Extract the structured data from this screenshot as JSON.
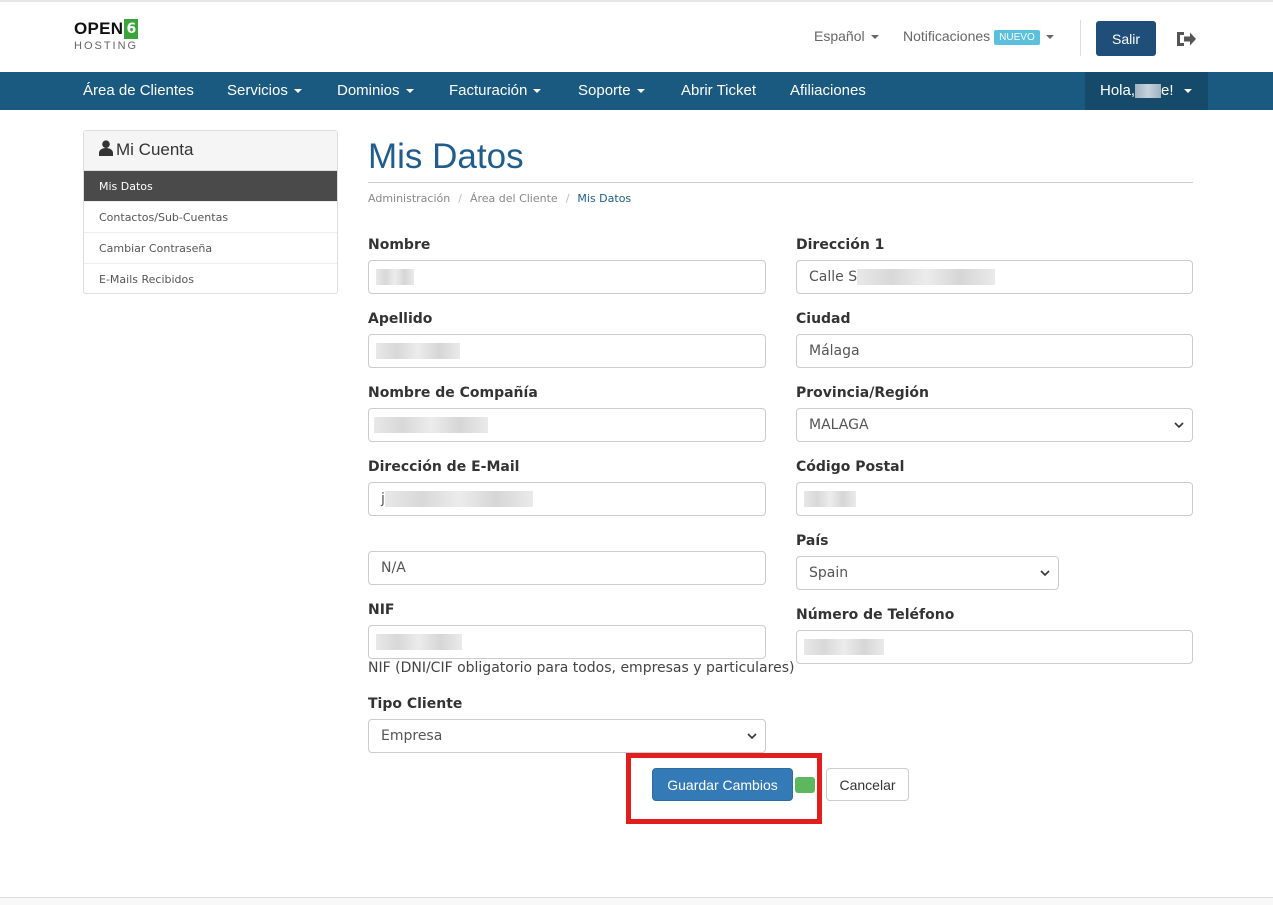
{
  "header": {
    "logo": {
      "brand": "OPEN",
      "digit": "6",
      "sub": "HOSTING"
    },
    "language": "Español",
    "notifications": "Notificaciones",
    "notif_badge": "NUEVO",
    "logout_button": "Salir"
  },
  "nav": {
    "items": [
      "Área de Clientes",
      "Servicios",
      "Dominios",
      "Facturación",
      "Soporte",
      "Abrir Ticket",
      "Afiliaciones"
    ],
    "greeting_prefix": "Hola,",
    "greeting_suffix": "e!"
  },
  "sidebar": {
    "title": "Mi Cuenta",
    "items": [
      "Mis Datos",
      "Contactos/Sub-Cuentas",
      "Cambiar Contraseña",
      "E-Mails Recibidos"
    ]
  },
  "main": {
    "title": "Mis Datos",
    "breadcrumb": [
      "Administración",
      "Área del Cliente",
      "Mis Datos"
    ]
  },
  "form": {
    "nombre_label": "Nombre",
    "apellido_label": "Apellido",
    "compania_label": "Nombre de Compañía",
    "email_label": "Dirección de E-Mail",
    "email_prefix": "j",
    "extra_value": "N/A",
    "nif_label": "NIF",
    "nif_help": "NIF (DNI/CIF obligatorio para todos, empresas y particulares)",
    "tipo_label": "Tipo Cliente",
    "tipo_value": "Empresa",
    "direccion_label": "Dirección 1",
    "direccion_prefix": "Calle S",
    "ciudad_label": "Ciudad",
    "ciudad_value": "Málaga",
    "provincia_label": "Provincia/Región",
    "provincia_value": "MALAGA",
    "postal_label": "Código Postal",
    "pais_label": "País",
    "pais_value": "Spain",
    "telefono_label": "Número de Teléfono"
  },
  "actions": {
    "save": "Guardar Cambios",
    "cancel": "Cancelar"
  },
  "colors": {
    "nav_bg": "#1a5a80",
    "title": "#1f5d8c",
    "primary_button": "#337ab7",
    "highlight": "#e21d1d"
  }
}
